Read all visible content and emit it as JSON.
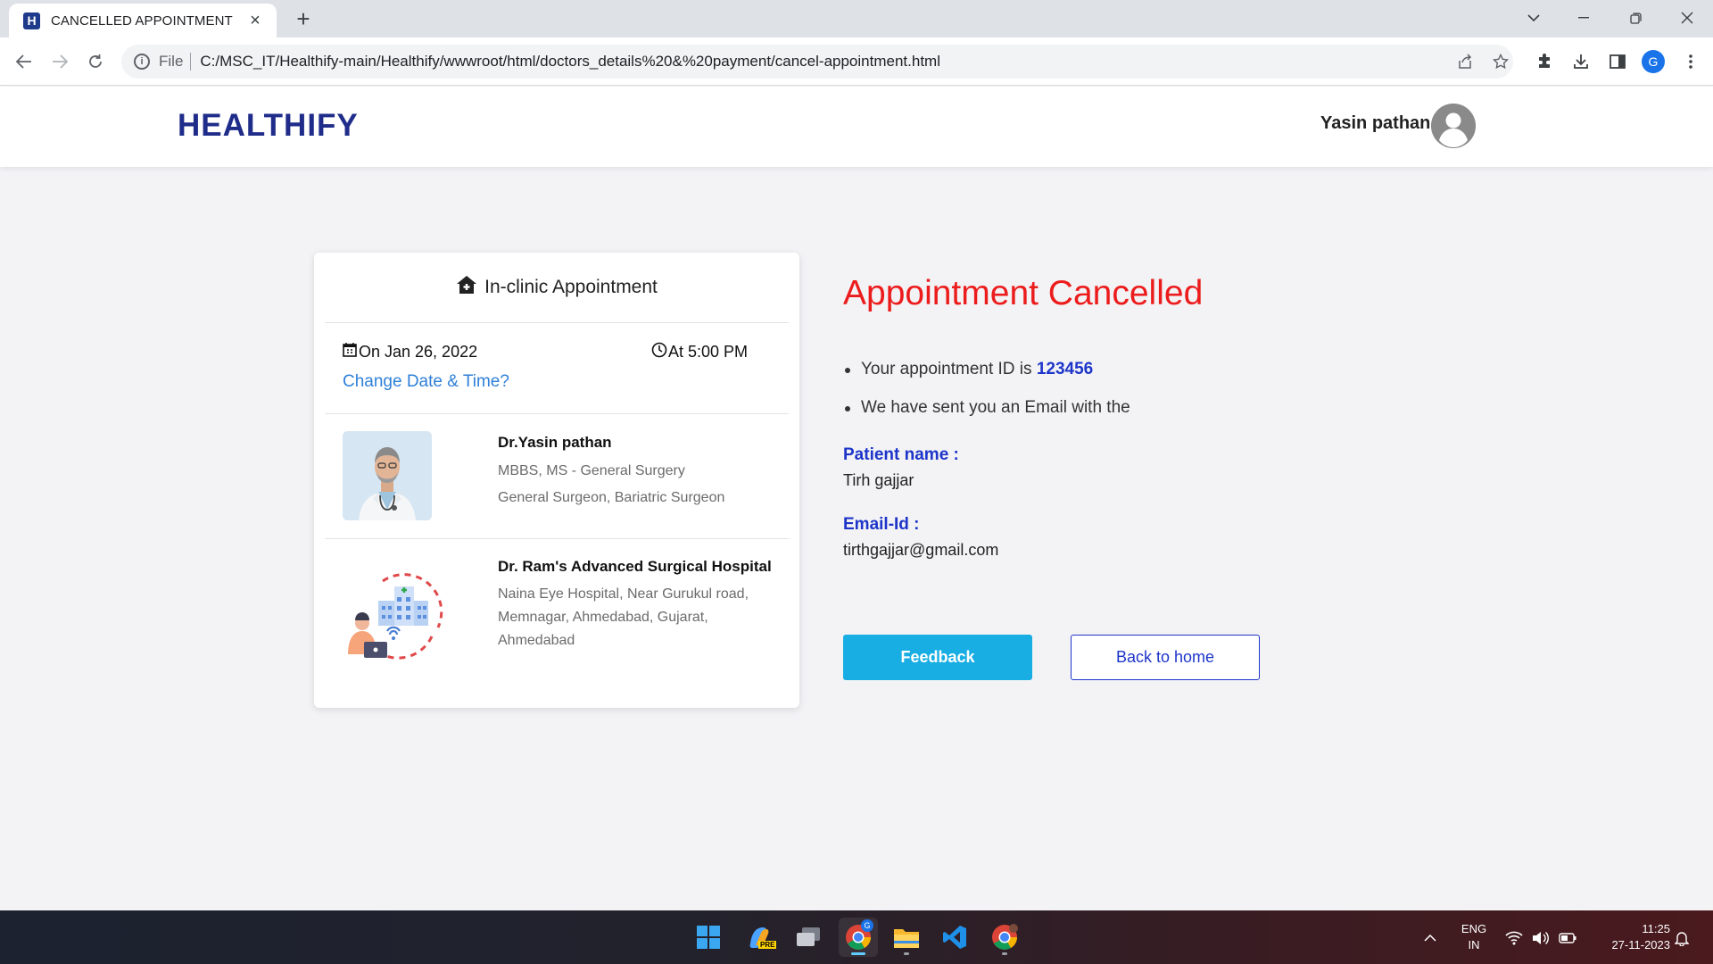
{
  "browser": {
    "tab_title": "CANCELLED APPOINTMENT",
    "tab_favicon_letter": "H",
    "file_label": "File",
    "url": "C:/MSC_IT/Healthify-main/Healthify/wwwroot/html/doctors_details%20&%20payment/cancel-appointment.html",
    "profile_letter": "G"
  },
  "header": {
    "brand": "HEALTHIFY",
    "user_name": "Yasin pathan"
  },
  "appointment_card": {
    "title": "In-clinic Appointment",
    "date": "On Jan 26, 2022",
    "time": "At 5:00 PM",
    "change_link": "Change Date & Time?",
    "doctor": {
      "name": "Dr.Yasin pathan",
      "qualification": "MBBS, MS - General Surgery",
      "specialty": "General Surgeon, Bariatric Surgeon"
    },
    "hospital": {
      "name": "Dr. Ram's Advanced Surgical Hospital",
      "address": "Naina Eye Hospital, Near Gurukul road, Memnagar, Ahmedabad, Gujarat, Ahmedabad"
    }
  },
  "confirmation": {
    "title": "Appointment Cancelled",
    "id_prefix": "Your appointment ID is",
    "appointment_id": "123456",
    "email_note": "We have sent you an Email with the",
    "patient_label": "Patient name :",
    "patient_name": "Tirh gajjar",
    "email_label": "Email-Id :",
    "email": "tirthgajjar@gmail.com",
    "feedback_button": "Feedback",
    "home_button": "Back to home"
  },
  "taskbar": {
    "language": "ENG",
    "region": "IN",
    "time": "11:25",
    "date": "27-11-2023",
    "copilot_badge": "PRE",
    "chrome_badge": "G"
  },
  "colors": {
    "brand": "#1f2c8a",
    "cancel_red": "#ec1c1c",
    "link_blue": "#2f80d8",
    "accent_blue": "#1d35c9",
    "feedback_bg": "#18aee3"
  }
}
